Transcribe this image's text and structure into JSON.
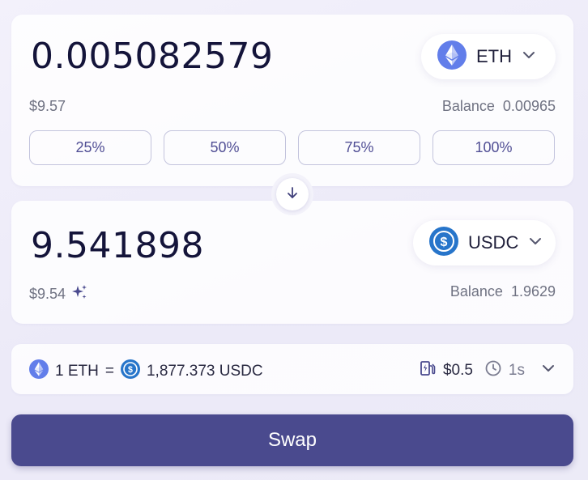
{
  "from": {
    "amount": "0.005082579",
    "usd_value": "$9.57",
    "token_symbol": "ETH",
    "token_icon": "ethereum-icon",
    "balance_label": "Balance",
    "balance_value": "0.00965",
    "percent_buttons": [
      "25%",
      "50%",
      "75%",
      "100%"
    ]
  },
  "switch": {
    "icon": "arrow-down-icon"
  },
  "to": {
    "amount": "9.541898",
    "usd_value": "$9.54",
    "usd_icon": "sparkle-icon",
    "token_symbol": "USDC",
    "token_icon": "usdc-icon",
    "balance_label": "Balance",
    "balance_value": "1.9629"
  },
  "rate": {
    "base": "1 ETH",
    "equals": "=",
    "quote": "1,877.373 USDC",
    "gas_fee": "$0.5",
    "gas_icon": "gas-pump-icon",
    "time": "1s",
    "time_icon": "clock-icon"
  },
  "actions": {
    "swap_label": "Swap"
  },
  "colors": {
    "accent": "#4a4a8e",
    "eth_blue": "#627eea",
    "usdc_blue": "#2775ca",
    "text_primary": "#14143a",
    "text_muted": "#6f7282"
  }
}
